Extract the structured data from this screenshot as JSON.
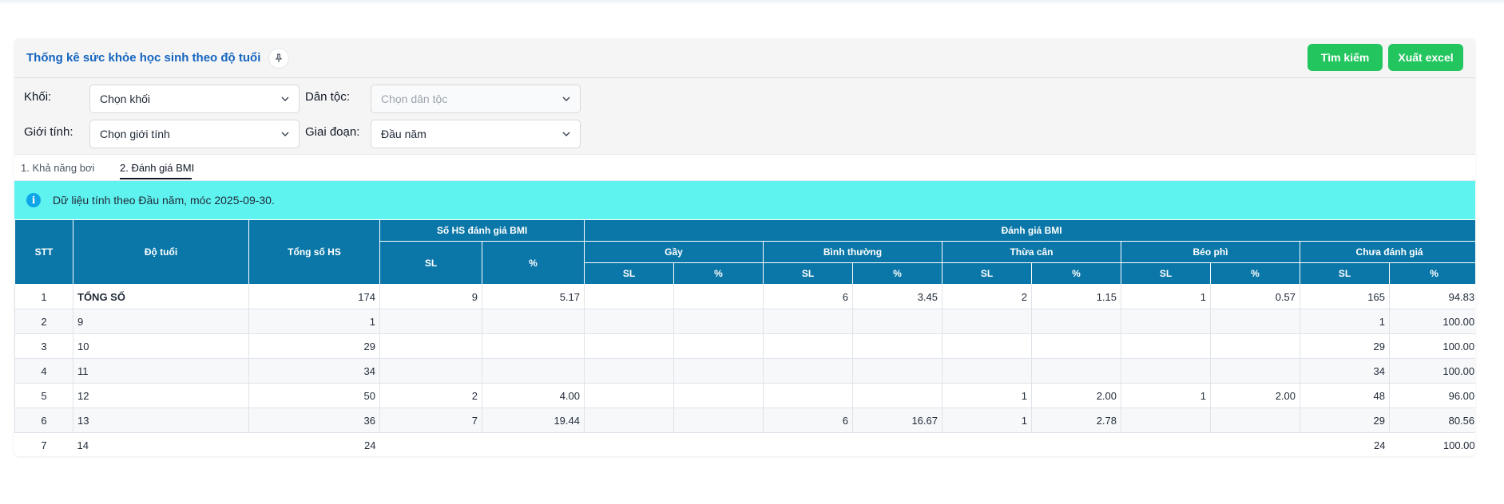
{
  "header": {
    "title": "Thống kê sức khỏe học sinh theo độ tuổi",
    "search_label": "Tìm kiếm",
    "export_label": "Xuất excel"
  },
  "filters": {
    "grade_label": "Khối:",
    "grade_value": "Chọn khối",
    "ethnicity_label": "Dân tộc:",
    "ethnicity_placeholder": "Chọn dân tộc",
    "gender_label": "Giới tính:",
    "gender_value": "Chọn giới tính",
    "period_label": "Giai đoạn:",
    "period_value": "Đầu năm"
  },
  "tabs": [
    {
      "label": "1. Khả năng bơi"
    },
    {
      "label": "2. Đánh giá BMI"
    }
  ],
  "info": {
    "text": "Dữ liệu tính theo Đầu năm, móc 2025-09-30."
  },
  "table": {
    "headers": {
      "stt": "STT",
      "age": "Độ tuổi",
      "total": "Tổng số HS",
      "evaluated": "Số HS đánh giá BMI",
      "bmi": "Đánh giá BMI",
      "thin": "Gầy",
      "normal": "Bình thường",
      "over": "Thừa cân",
      "obese": "Béo phì",
      "not_eval": "Chưa đánh giá",
      "sl": "SL",
      "pct": "%"
    },
    "rows": [
      {
        "stt": "1",
        "age": "TỔNG SỐ",
        "total": "174",
        "eval_sl": "9",
        "eval_pct": "5.17",
        "thin_sl": "",
        "thin_pct": "",
        "normal_sl": "6",
        "normal_pct": "3.45",
        "over_sl": "2",
        "over_pct": "1.15",
        "obese_sl": "1",
        "obese_pct": "0.57",
        "ne_sl": "165",
        "ne_pct": "94.83"
      },
      {
        "stt": "2",
        "age": "9",
        "total": "1",
        "eval_sl": "",
        "eval_pct": "",
        "thin_sl": "",
        "thin_pct": "",
        "normal_sl": "",
        "normal_pct": "",
        "over_sl": "",
        "over_pct": "",
        "obese_sl": "",
        "obese_pct": "",
        "ne_sl": "1",
        "ne_pct": "100.00"
      },
      {
        "stt": "3",
        "age": "10",
        "total": "29",
        "eval_sl": "",
        "eval_pct": "",
        "thin_sl": "",
        "thin_pct": "",
        "normal_sl": "",
        "normal_pct": "",
        "over_sl": "",
        "over_pct": "",
        "obese_sl": "",
        "obese_pct": "",
        "ne_sl": "29",
        "ne_pct": "100.00"
      },
      {
        "stt": "4",
        "age": "11",
        "total": "34",
        "eval_sl": "",
        "eval_pct": "",
        "thin_sl": "",
        "thin_pct": "",
        "normal_sl": "",
        "normal_pct": "",
        "over_sl": "",
        "over_pct": "",
        "obese_sl": "",
        "obese_pct": "",
        "ne_sl": "34",
        "ne_pct": "100.00"
      },
      {
        "stt": "5",
        "age": "12",
        "total": "50",
        "eval_sl": "2",
        "eval_pct": "4.00",
        "thin_sl": "",
        "thin_pct": "",
        "normal_sl": "",
        "normal_pct": "",
        "over_sl": "1",
        "over_pct": "2.00",
        "obese_sl": "1",
        "obese_pct": "2.00",
        "ne_sl": "48",
        "ne_pct": "96.00"
      },
      {
        "stt": "6",
        "age": "13",
        "total": "36",
        "eval_sl": "7",
        "eval_pct": "19.44",
        "thin_sl": "",
        "thin_pct": "",
        "normal_sl": "6",
        "normal_pct": "16.67",
        "over_sl": "1",
        "over_pct": "2.78",
        "obese_sl": "",
        "obese_pct": "",
        "ne_sl": "29",
        "ne_pct": "80.56"
      },
      {
        "stt": "7",
        "age": "14",
        "total": "24",
        "eval_sl": "",
        "eval_pct": "",
        "thin_sl": "",
        "thin_pct": "",
        "normal_sl": "",
        "normal_pct": "",
        "over_sl": "",
        "over_pct": "",
        "obese_sl": "",
        "obese_pct": "",
        "ne_sl": "24",
        "ne_pct": "100.00"
      }
    ]
  },
  "icons": {
    "pin": "pin-icon",
    "info": "info-icon",
    "chevron": "chevron-down-icon"
  },
  "colors": {
    "title": "#1565c0",
    "button": "#22c55e",
    "table_header": "#0b77a8",
    "info_bar": "#5ff3f0"
  }
}
